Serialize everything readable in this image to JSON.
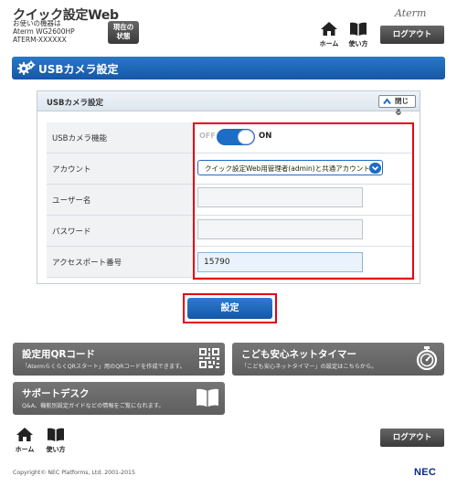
{
  "header": {
    "app_title": "クイック設定Web",
    "device_label": "お使いの機器は",
    "device_model": "Aterm WG2600HP",
    "device_id": "ATERM-XXXXXX",
    "status_line1": "現在の",
    "status_line2": "状態",
    "brand_logo": "Aterm",
    "home_label": "ホーム",
    "help_label": "使い方",
    "logout_label": "ログアウト"
  },
  "page": {
    "title": "USBカメラ設定"
  },
  "panel": {
    "title": "USBカメラ設定",
    "close_label": "閉じる",
    "rows": [
      {
        "label": "USBカメラ機能"
      },
      {
        "label": "アカウント"
      },
      {
        "label": "ユーザー名"
      },
      {
        "label": "パスワード"
      },
      {
        "label": "アクセスポート番号"
      }
    ],
    "toggle": {
      "off_label": "OFF",
      "on_label": "ON",
      "state": "on"
    },
    "account_selected": "クイック設定Web用管理者(admin)と共通アカウント",
    "username_value": "",
    "password_value": "",
    "port_value": "15790",
    "submit_label": "設定"
  },
  "tiles": [
    {
      "title": "設定用QRコード",
      "sub": "「AtermらくらくQRスタート」用のQRコードを作成できます。",
      "icon": "qr-code-icon"
    },
    {
      "title": "こども安心ネットタイマー",
      "sub": "「こども安心ネットタイマー」の設定はこちらから。",
      "icon": "stopwatch-icon"
    },
    {
      "title": "サポートデスク",
      "sub": "Q&A、機能別設定ガイドなどの情報をご覧になれます。",
      "icon": "book-icon"
    }
  ],
  "footer": {
    "home_label": "ホーム",
    "help_label": "使い方",
    "logout_label": "ログアウト",
    "copyright": "Copyright© NEC Platforms, Ltd. 2001-2015",
    "brand": "NEC"
  },
  "colors": {
    "accent_blue": "#1e6dc4",
    "highlight_red": "#e60012",
    "tile_gray": "#6a6a6a"
  }
}
